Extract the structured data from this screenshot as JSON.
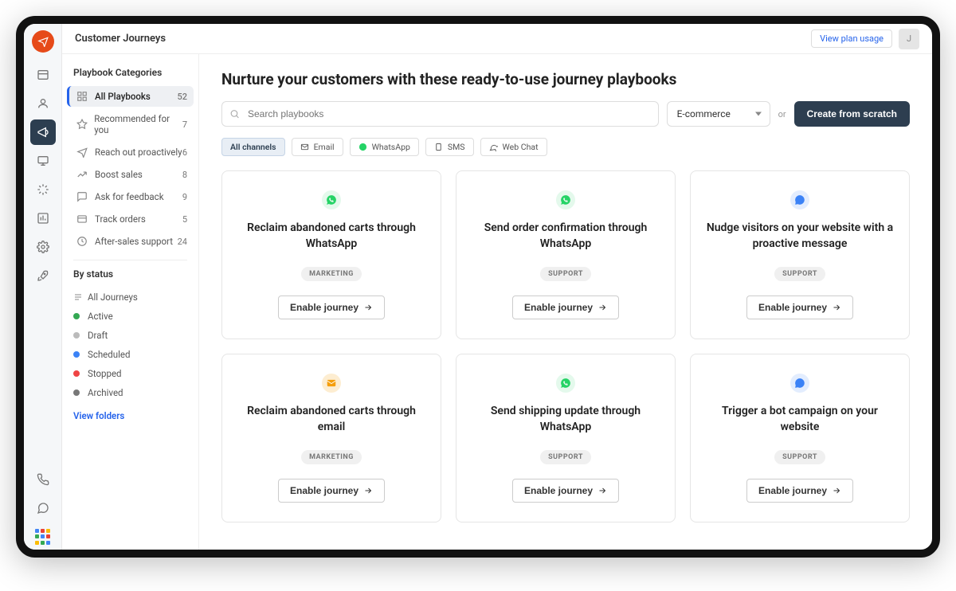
{
  "topbar": {
    "title": "Customer Journeys",
    "plan_link": "View plan usage",
    "avatar_initial": "J"
  },
  "sidebar": {
    "heading": "Playbook Categories",
    "categories": [
      {
        "label": "All Playbooks",
        "count": 52,
        "active": true
      },
      {
        "label": "Recommended for you",
        "count": 7
      },
      {
        "label": "Reach out proactively",
        "count": 6
      },
      {
        "label": "Boost sales",
        "count": 8
      },
      {
        "label": "Ask for feedback",
        "count": 9
      },
      {
        "label": "Track orders",
        "count": 5
      },
      {
        "label": "After-sales support",
        "count": 24
      }
    ],
    "status_heading": "By status",
    "statuses": [
      {
        "label": "All Journeys",
        "color": ""
      },
      {
        "label": "Active",
        "color": "#34a853"
      },
      {
        "label": "Draft",
        "color": "#bbb"
      },
      {
        "label": "Scheduled",
        "color": "#3b82f6"
      },
      {
        "label": "Stopped",
        "color": "#ef4444"
      },
      {
        "label": "Archived",
        "color": "#777"
      }
    ],
    "view_folders": "View folders"
  },
  "main": {
    "heading": "Nurture your customers with these ready-to-use journey playbooks",
    "search_placeholder": "Search playbooks",
    "dropdown_value": "E-commerce",
    "or_text": "or",
    "create_btn": "Create from scratch",
    "chips": [
      {
        "label": "All channels",
        "active": true
      },
      {
        "label": "Email",
        "icon": "mail"
      },
      {
        "label": "WhatsApp",
        "icon": "whatsapp"
      },
      {
        "label": "SMS",
        "icon": "sms"
      },
      {
        "label": "Web Chat",
        "icon": "chat"
      }
    ],
    "enable_label": "Enable journey",
    "cards": [
      {
        "icon": "whatsapp",
        "icon_color": "#25d366",
        "title": "Reclaim abandoned carts through WhatsApp",
        "badge": "MARKETING"
      },
      {
        "icon": "whatsapp",
        "icon_color": "#25d366",
        "title": "Send order confirmation through WhatsApp",
        "badge": "SUPPORT"
      },
      {
        "icon": "chat",
        "icon_color": "#3b82f6",
        "title": "Nudge visitors on your website with a proactive message",
        "badge": "SUPPORT"
      },
      {
        "icon": "mail",
        "icon_color": "#f59e0b",
        "title": "Reclaim abandoned carts through email",
        "badge": "MARKETING"
      },
      {
        "icon": "whatsapp",
        "icon_color": "#25d366",
        "title": "Send shipping update through WhatsApp",
        "badge": "SUPPORT"
      },
      {
        "icon": "chat",
        "icon_color": "#3b82f6",
        "title": "Trigger a bot campaign on your website",
        "badge": "SUPPORT"
      }
    ]
  }
}
